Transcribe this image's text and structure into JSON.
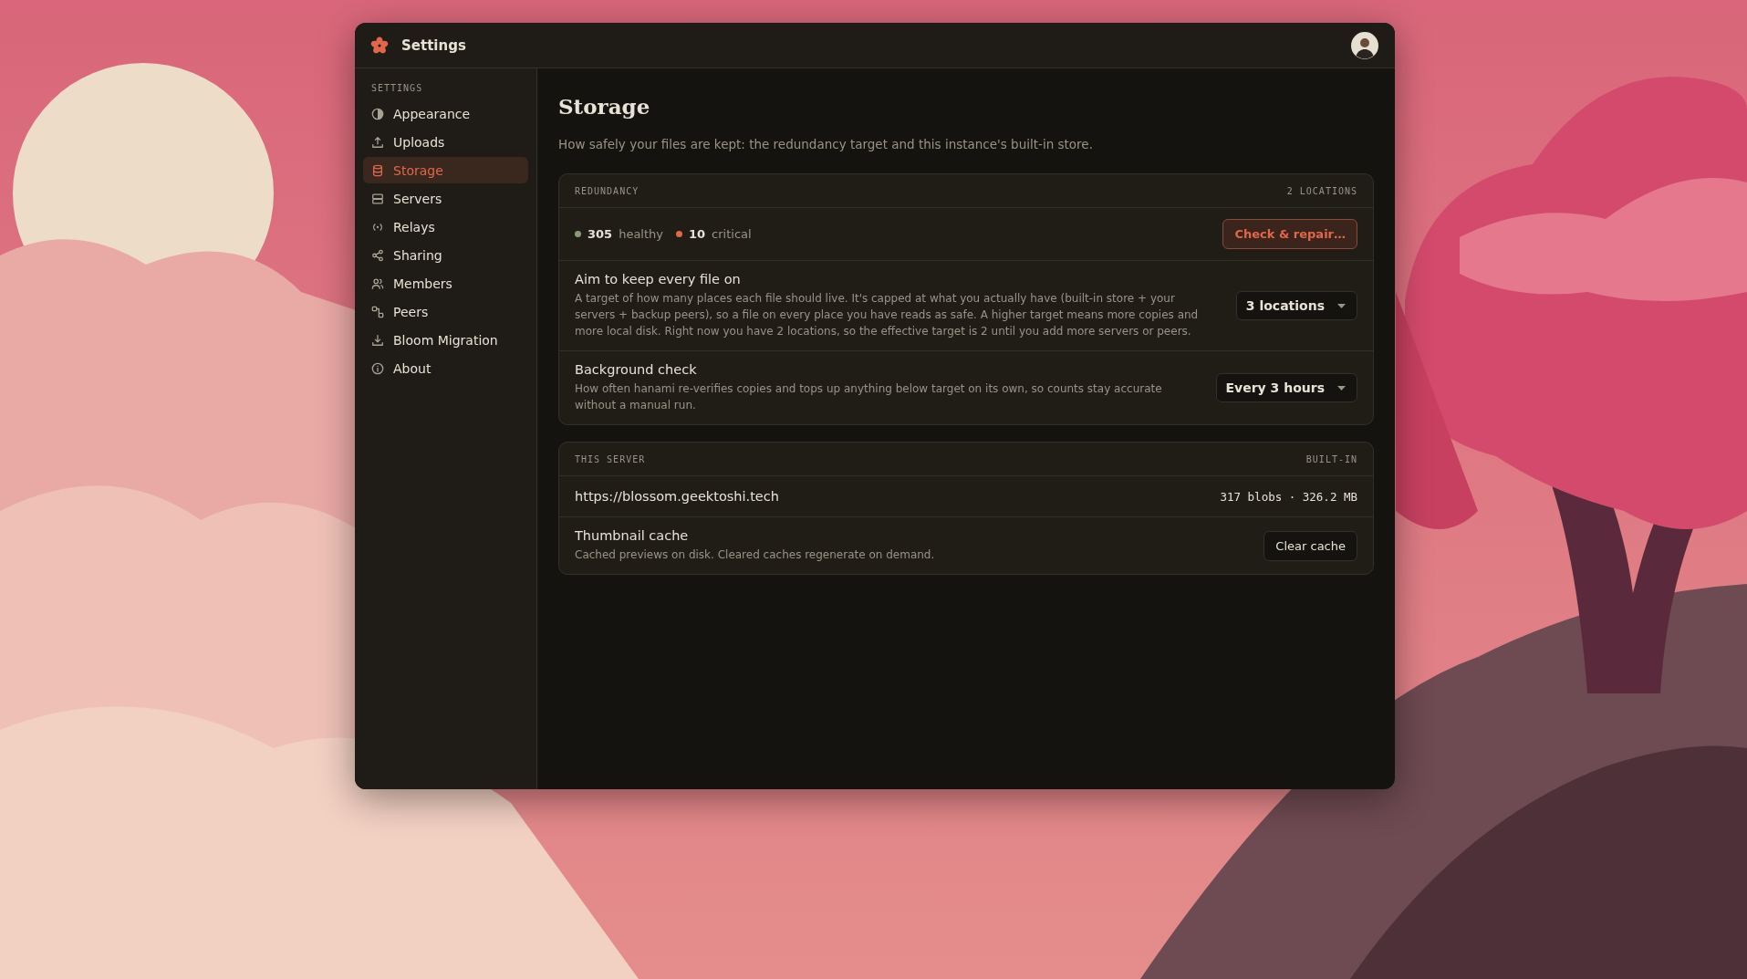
{
  "app": {
    "title": "Settings"
  },
  "sidebar": {
    "heading": "SETTINGS",
    "items": [
      {
        "label": "Appearance",
        "selected": false
      },
      {
        "label": "Uploads",
        "selected": false
      },
      {
        "label": "Storage",
        "selected": true
      },
      {
        "label": "Servers",
        "selected": false
      },
      {
        "label": "Relays",
        "selected": false
      },
      {
        "label": "Sharing",
        "selected": false
      },
      {
        "label": "Members",
        "selected": false
      },
      {
        "label": "Peers",
        "selected": false
      },
      {
        "label": "Bloom Migration",
        "selected": false
      },
      {
        "label": "About",
        "selected": false
      }
    ]
  },
  "page": {
    "title": "Storage",
    "description": "How safely your files are kept: the redundancy target and this instance's built-in store.",
    "sections": [
      {
        "heading": "REDUNDANCY",
        "badge": "2 LOCATIONS",
        "rows": [
          {
            "kind": "stats",
            "stats": [
              {
                "value": "305",
                "label": "healthy",
                "color": "#8a9a78"
              },
              {
                "value": "10",
                "label": "critical",
                "color": "#e0674c"
              }
            ],
            "button": "Check & repair…"
          },
          {
            "kind": "select",
            "title": "Aim to keep every file on",
            "description": "A target of how many places each file should live. It's capped at what you actually have (built-in store + your servers + backup peers), so a file on every place you have reads as safe. A higher target means more copies and more local disk. Right now you have 2 locations, so the effective target is 2 until you add more servers or peers.",
            "value": "3 locations"
          },
          {
            "kind": "select",
            "title": "Background check",
            "description": "How often hanami re-verifies copies and tops up anything below target on its own, so counts stay accurate without a manual run.",
            "value": "Every 3 hours"
          }
        ]
      },
      {
        "heading": "THIS SERVER",
        "badge": "BUILT-IN",
        "rows": [
          {
            "kind": "info",
            "label": "https://blossom.geektoshi.tech",
            "value": "317 blobs · 326.2 MB"
          },
          {
            "kind": "action",
            "title": "Thumbnail cache",
            "description": "Cached previews on disk. Cleared caches regenerate on demand.",
            "button": "Clear cache"
          }
        ]
      }
    ]
  }
}
